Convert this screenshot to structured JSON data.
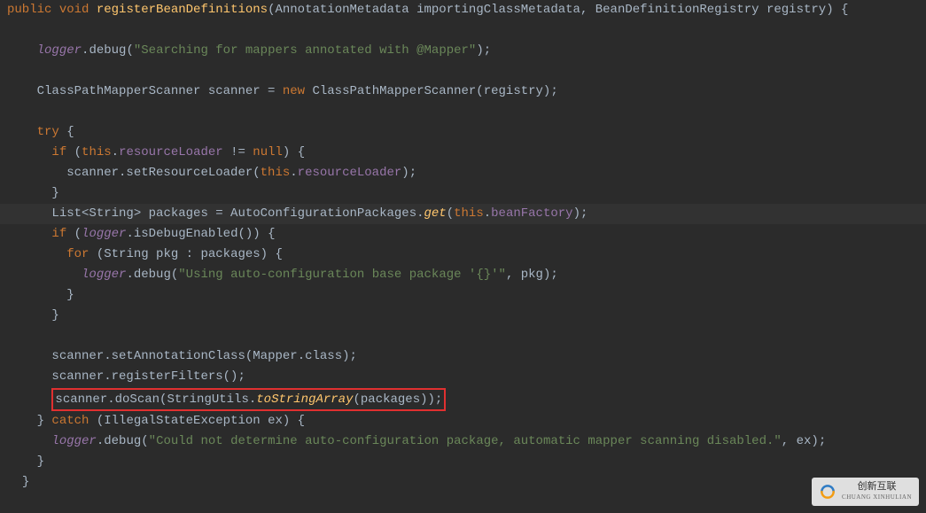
{
  "code": {
    "l1": {
      "kw1": "public",
      "kw2": "void",
      "method": "registerBeanDefinitions",
      "p1": "(AnnotationMetadata importingClassMetadata",
      "sep": ", ",
      "p2": "BeanDefinitionRegistry registry) {"
    },
    "l3": {
      "logger": "logger",
      "dot": ".",
      "debug": "debug",
      "open": "(",
      "str": "\"Searching for mappers annotated with @Mapper\"",
      "close": ");"
    },
    "l5": {
      "part1": "ClassPathMapperScanner scanner = ",
      "kw": "new",
      "part2": " ClassPathMapperScanner(registry);"
    },
    "l7": {
      "kw": "try",
      "brace": " {"
    },
    "l8": {
      "kw": "if",
      "open": " (",
      "this": "this",
      "dot": ".",
      "field": "resourceLoader",
      "cmp": " != ",
      "null": "null",
      "close": ") {"
    },
    "l9": {
      "obj": "scanner.setResourceLoader(",
      "this": "this",
      "dot": ".",
      "field": "resourceLoader",
      "close": ");"
    },
    "l10": {
      "brace": "}"
    },
    "l12": {
      "part1": "List<String> packages = AutoConfigurationPackages.",
      "get": "get",
      "open": "(",
      "this": "this",
      "dot": ".",
      "field": "beanFactory",
      "close": ");"
    },
    "l13": {
      "kw": "if",
      "open": " (",
      "logger": "logger",
      "call": ".isDebugEnabled()) {"
    },
    "l14": {
      "kw": "for",
      "rest": " (String pkg : packages) {"
    },
    "l15": {
      "logger": "logger",
      "dot": ".",
      "debug": "debug",
      "open": "(",
      "str": "\"Using auto-configuration base package '{}'\"",
      "sep": ", ",
      "var": "pkg",
      "close": ");"
    },
    "l16": {
      "brace": "}"
    },
    "l17": {
      "brace": "}"
    },
    "l19": {
      "obj": "scanner.setAnnotationClass(",
      "cls": "Mapper",
      "rest": ".class);"
    },
    "l20": {
      "txt": "scanner.registerFilters();"
    },
    "l21": {
      "part1": "scanner.doScan(StringUtils.",
      "method": "toStringArray",
      "part2": "(packages));"
    },
    "l22": {
      "brace": "} ",
      "kw": "catch",
      "rest": " (IllegalStateException ex) {"
    },
    "l23": {
      "logger": "logger",
      "dot": ".",
      "debug": "debug",
      "open": "(",
      "str": "\"Could not determine auto-configuration package, automatic mapper scanning disabled.\"",
      "sep": ", ",
      "var": "ex",
      "close": ");"
    },
    "l24": {
      "brace": "}"
    },
    "l25": {
      "brace": "}"
    }
  },
  "watermark": {
    "cn": "创新互联",
    "en": "CHUANG XINHULIAN"
  }
}
